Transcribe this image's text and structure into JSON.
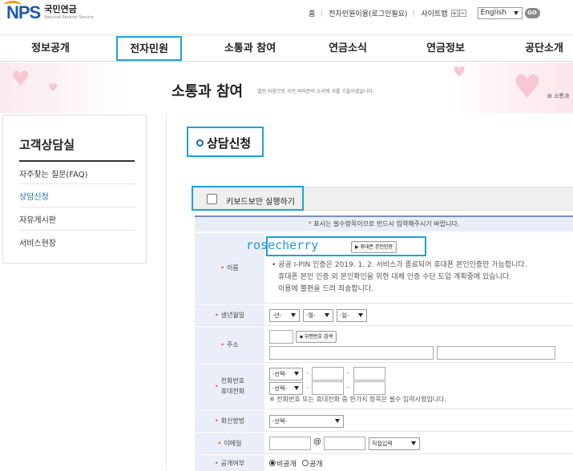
{
  "header": {
    "logo": {
      "brand": "NPS",
      "name_kr": "국민연금",
      "name_en": "National Pension Service"
    },
    "util_links": [
      "홈",
      "전자민원이용(로그인필요)",
      "사이트맵"
    ],
    "zoom": {
      "plus": "+",
      "minus": "−"
    },
    "language": "English",
    "go_label": "GO"
  },
  "gnb": [
    "정보공개",
    "전자민원",
    "소통과 참여",
    "연금소식",
    "연금정보",
    "공단소개"
  ],
  "visual": {
    "title": "소통과 참여",
    "subtitle": "열린 마음으로 국민 여러분의 소리에 귀를 기울이겠습니다.",
    "breadcrumb": "⊞ 소통과"
  },
  "sidebar": {
    "title": "고객상담실",
    "items": [
      {
        "label": "자주찾는 질문(FAQ)",
        "active": false
      },
      {
        "label": "상담신청",
        "active": true
      },
      {
        "label": "자유게시판",
        "active": false
      },
      {
        "label": "서비스현장",
        "active": false
      }
    ]
  },
  "page": {
    "title": "상담신청"
  },
  "keyboard": {
    "label": "키보드보안 실행하기",
    "checked": false
  },
  "notice": {
    "mark": "*",
    "text": "표시는 필수항목이므로 반드시 입력해주시기 바랍니다."
  },
  "form": {
    "name": {
      "label": "이름",
      "typed_user": "rosecherry",
      "verify_button": "▶ 휴대폰 본인인증",
      "note_1": "공공 I-PIN 인증은 2019. 1. 2. 서비스가 종료되어 휴대폰 본인인증만 가능합니다.",
      "note_2": "휴대폰 본인 인증 외 본인확인을 위한 대체 인증 수단 도입 계획중에 있습니다.",
      "note_3": "이용에 불편을 드려 죄송합니다."
    },
    "birth": {
      "label": "생년월일",
      "year": "-년-",
      "month": "-월-",
      "day": "-일-"
    },
    "address": {
      "label": "주소",
      "zip_button": "우편번호 검색"
    },
    "phone": {
      "label_1": "전화번호",
      "label_2": "휴대전화",
      "select": "-선택-",
      "dash": "-",
      "note": "※ 전화번호 또는 휴대전화 중 한가지 항목은 필수 입력사항입니다."
    },
    "reply": {
      "label": "회신방법",
      "select": "-선택-"
    },
    "email": {
      "label": "이메일",
      "at": "@",
      "domain_select": "직접입력"
    },
    "public": {
      "label": "공개여부",
      "options": [
        "비공개",
        "공개"
      ],
      "selected": "비공개"
    }
  },
  "colors": {
    "highlight": "#1ea0dc",
    "brand": "#1c5aa8",
    "required": "#e84b2a",
    "label_bg": "#e9eef8"
  }
}
